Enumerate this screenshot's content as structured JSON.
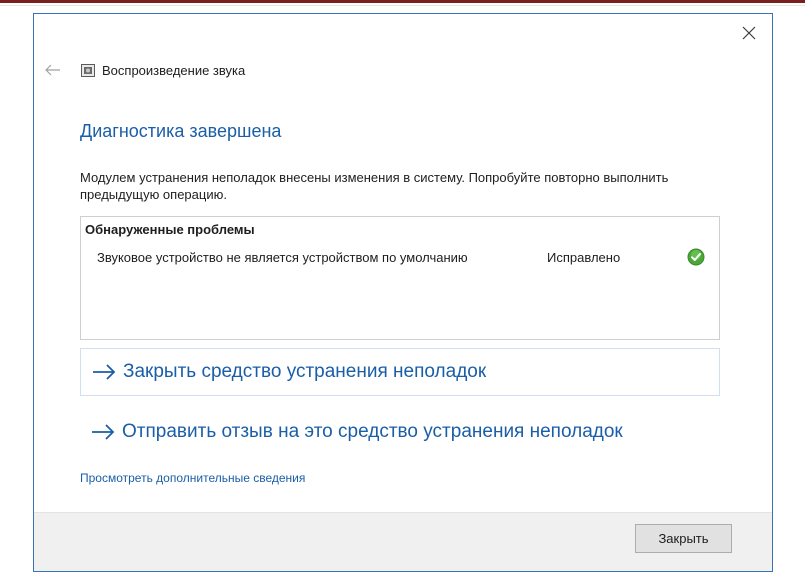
{
  "window": {
    "title": "Воспроизведение звука",
    "app_icon": "speaker-icon",
    "accent_color": "#1a5ea8",
    "border_color": "#3a72b8"
  },
  "controls": {
    "back_icon": "back-arrow-icon",
    "close_icon": "close-icon"
  },
  "content": {
    "heading": "Диагностика завершена",
    "message": "Модулем устранения неполадок внесены изменения в систему. Попробуйте повторно выполнить предыдущую операцию.",
    "problems": {
      "header": "Обнаруженные проблемы",
      "items": [
        {
          "description": "Звуковое устройство не является устройством по умолчанию",
          "status": "Исправлено",
          "status_icon": "check-icon",
          "status_color": "#4aa838"
        }
      ]
    },
    "actions": [
      {
        "label": "Закрыть средство устранения неполадок",
        "icon": "arrow-right-icon"
      },
      {
        "label": "Отправить отзыв на это средство устранения неполадок",
        "icon": "arrow-right-icon"
      }
    ],
    "details_link": "Просмотреть дополнительные сведения"
  },
  "footer": {
    "close_button": "Закрыть"
  }
}
